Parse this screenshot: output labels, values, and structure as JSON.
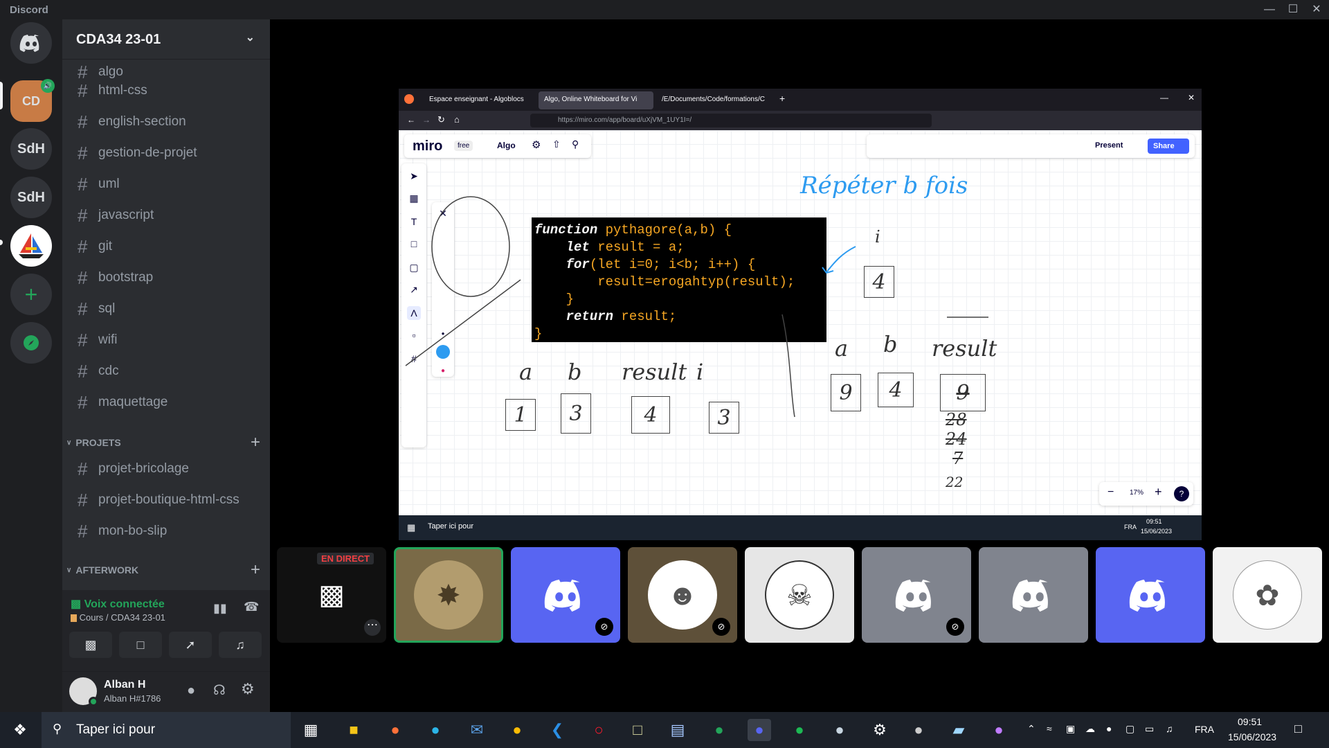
{
  "window": {
    "title": "Discord",
    "controls": [
      "minimize",
      "maximize",
      "close"
    ]
  },
  "server_rail": {
    "items": [
      {
        "label": "",
        "icon": "discord-logo-icon"
      },
      {
        "label": "CD",
        "icon": "server-cda-icon",
        "badge": "speaker"
      },
      {
        "label": "SdH",
        "icon": ""
      },
      {
        "label": "SdH",
        "icon": ""
      },
      {
        "label": "",
        "icon": "sailboat-icon"
      },
      {
        "label": "+",
        "icon": "add-server-icon"
      },
      {
        "label": "",
        "icon": "compass-icon"
      }
    ]
  },
  "sidebar": {
    "server_name": "CDA34 23-01",
    "partial_channel": "algo",
    "channels": [
      "html-css",
      "english-section",
      "gestion-de-projet",
      "uml",
      "javascript",
      "git",
      "bootstrap",
      "sql",
      "wifi",
      "cdc",
      "maquettage"
    ],
    "categories": [
      {
        "name": "PROJETS",
        "channels": [
          "projet-bricolage",
          "projet-boutique-html-css",
          "mon-bo-slip"
        ]
      },
      {
        "name": "AFTERWORK",
        "channels": []
      }
    ]
  },
  "voice": {
    "status": "Voix connectée",
    "location": "Cours / CDA34 23-01"
  },
  "user": {
    "name": "Alban H",
    "tag": "Alban H#1786"
  },
  "browser": {
    "tabs": [
      "Espace enseignant - Algoblocs",
      "Algo, Online Whiteboard for Vi",
      "/E/Documents/Code/formations/C"
    ],
    "url": "https://miro.com/app/board/uXjVM_1UY1I=/"
  },
  "miro": {
    "logo": "miro",
    "plan": "free",
    "board_name": "Algo",
    "present_label": "Present",
    "share_label": "Share",
    "zoom": "17%",
    "code_lines": [
      {
        "kw": "function",
        "rest": " pythagore(a,b) {"
      },
      {
        "kw": "    let",
        "rest": " result = a;"
      },
      {
        "kw": "    for",
        "rest": "(let i=0; i<b; i++) {"
      },
      {
        "kw": "",
        "rest": "        result=erogahtyp(result);"
      },
      {
        "kw": "",
        "rest": "    }"
      },
      {
        "kw": "    return",
        "rest": " result;"
      },
      {
        "kw": "",
        "rest": "}"
      }
    ],
    "handwriting": {
      "note": "Répéter b fois",
      "labels_left": [
        "a",
        "b",
        "result",
        "i"
      ],
      "values_left": [
        "1",
        "3",
        "4",
        "3"
      ],
      "labels_right": [
        "a",
        "b",
        "result"
      ],
      "values_right": [
        "9",
        "4",
        "9"
      ],
      "result_sequence": [
        "28",
        "24",
        "7",
        "22"
      ],
      "i_box": "4",
      "i_label": "i"
    },
    "inner_taskbar": {
      "search": "Taper ici pour",
      "lang": "FRA",
      "time": "09:51",
      "date": "15/06/2023"
    }
  },
  "video_strip": {
    "live_badge": "EN DIRECT"
  },
  "taskbar": {
    "search_placeholder": "Taper ici pour",
    "lang": "FRA",
    "time": "09:51",
    "date": "15/06/2023"
  },
  "colors": {
    "discord_blurple": "#5865f2",
    "green": "#23a55a",
    "dark": "#1e1f22"
  }
}
